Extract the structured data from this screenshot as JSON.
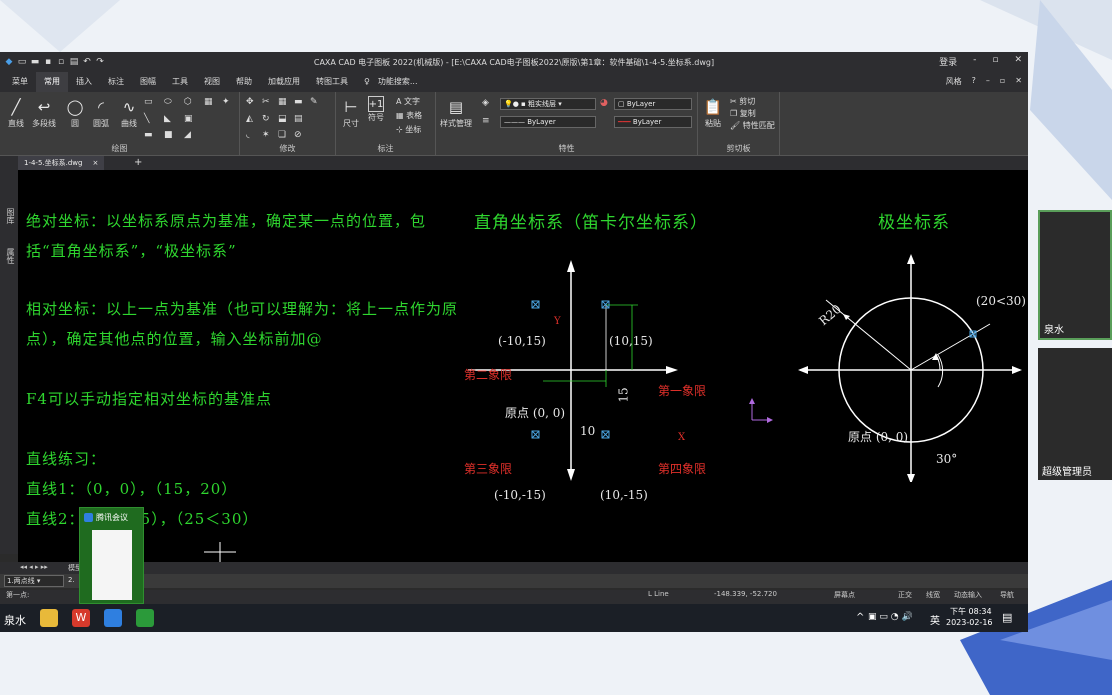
{
  "app": {
    "title": "CAXA CAD 电子图板 2022(机械版) - [E:\\CAXA CAD电子图板2022\\原版\\第1章：软件基础\\1-4-5.坐标系.dwg]",
    "login": "登录",
    "window_controls": [
      "-",
      "▫",
      "✕"
    ]
  },
  "menu": {
    "items": [
      "菜单",
      "常用",
      "插入",
      "标注",
      "图幅",
      "工具",
      "视图",
      "帮助",
      "加载应用",
      "转图工具"
    ],
    "active": "常用",
    "search": "功能搜索...",
    "style": "风格",
    "help": "?"
  },
  "ribbon": {
    "draw": {
      "label": "绘图",
      "tools": [
        "直线",
        "多段线",
        "圆",
        "圆弧",
        "曲线"
      ]
    },
    "modify": {
      "label": "修改"
    },
    "annotate": {
      "label": "标注",
      "tools": [
        "尺寸",
        "符号"
      ],
      "side": [
        "文字",
        "表格",
        "坐标"
      ]
    },
    "props": {
      "label": "特性",
      "style_mgr": "样式管理",
      "layer": "粗实线层",
      "color": "ByLayer",
      "linetype": "ByLayer",
      "lineweight": "ByLayer"
    },
    "clipboard": {
      "label": "剪切板",
      "paste": "粘贴",
      "cut": "剪切",
      "copy": "复制",
      "match": "特性匹配"
    }
  },
  "tabs": {
    "doc": "1-4-5.坐标系.dwg",
    "close": "×",
    "add": "+"
  },
  "sidebar": {
    "items": [
      "图库",
      "属性"
    ]
  },
  "canvas": {
    "notes": [
      "绝对坐标：以坐标系原点为基准，确定某一点的位置，包",
      "括“直角坐标系”，“极坐标系”",
      "相对坐标：以上一点为基准（也可以理解为：将上一点作为原",
      "点），确定其他点的位置，输入坐标前加@",
      "F4可以手动指定相对坐标的基准点",
      "直线练习：",
      "直线1：（0，0），（15，20）",
      "直线2：（25，25），（25＜30）"
    ],
    "cartesian": {
      "title": "直角坐标系（笛卡尔坐标系）",
      "y": "Y",
      "x": "X",
      "p1": "(10,15)",
      "p2": "(-10,15)",
      "p3": "(-10,-15)",
      "p4": "(10,-15)",
      "origin": "原点 (0, 0)",
      "q1": "第一象限",
      "q2": "第二象限",
      "q3": "第三象限",
      "q4": "第四象限",
      "dim_h": "10",
      "dim_v": "15"
    },
    "polar": {
      "title": "极坐标系",
      "radius": "R20",
      "point": "(20<30)",
      "origin": "原点 (0, 0)",
      "angle": "30°"
    }
  },
  "bottom": {
    "layout_tab": "模型",
    "cmd_combo": "1.两点线",
    "cmd_combo2": "2.",
    "prompt": "第一点:",
    "status": [
      "L Line",
      "-148.339, -52.720",
      "屏幕点",
      "正交",
      "线宽",
      "动态输入",
      "导航"
    ]
  },
  "taskbar": {
    "user": "泉水",
    "time": "下午 08:34",
    "date": "2023-02-16",
    "ime": "英",
    "tray": "^"
  },
  "popup": {
    "title": "腾讯会议"
  },
  "participants": [
    "泉水",
    "超级管理员"
  ]
}
